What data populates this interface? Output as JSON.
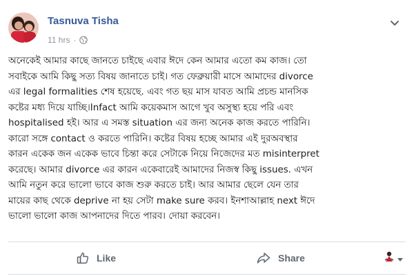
{
  "post": {
    "author_name": "Tasnuva Tisha",
    "timestamp": "11 hrs",
    "separator": "·",
    "privacy_icon": "globe-icon",
    "lines": [
      "অনেকেই আমার কাছে জানতে চাইছে এবার ঈদে কেন আমার এতো কম কাজ। তো",
      "সবাইকে আমি কিছু সত্য বিষয় জানাতে চাই। গত ফেব্রুয়ারী মাসে আমাদের divorce",
      "এর legal formalities শেষ হয়েছে. এবং গত ছয় মাস যাবত আমি প্রচন্ড মানসিক",
      "কষ্টের মধ্য দিয়ে যাচ্ছি।Infact আমি কয়েকমাস আগে খুব অসুস্থ্য হয়ে পরি এবং",
      "hospitalised হই। আর এ সমস্ত situation এর জন্য অনেক কাজ করতে পারিনি।",
      "কারো সঙ্গে contact ও করতে পারিনি। কষ্টের বিষয় হচ্ছে আমার এই দুরঅবস্থার",
      "কারন একেক জন একেক ভাবে চিন্তা করে সেটাকে নিয়ে নিজেদের মত misinterpret",
      "করেছে। আমার divorce এর কারন একেবারেই আমাদের নিজস্ব কিছু issues. এখন",
      "আমি নতুন করে ভালো ভাবে কাজ শুরু করতে চাই। আর আমার ছেলে যেন তার",
      "মায়ের কাছ থেকে deprive না হয় সেটা make sure করব। ইনশাআল্লাহ next ঈদে",
      "ভালো ভালো কাজ আপনাদের দিতে পারব। দোয়া করবেন।"
    ]
  },
  "actions": {
    "like_label": "Like",
    "share_label": "Share"
  },
  "colors": {
    "name": "#385898",
    "meta": "#90949c",
    "action": "#606770",
    "divider": "#dadde1"
  }
}
